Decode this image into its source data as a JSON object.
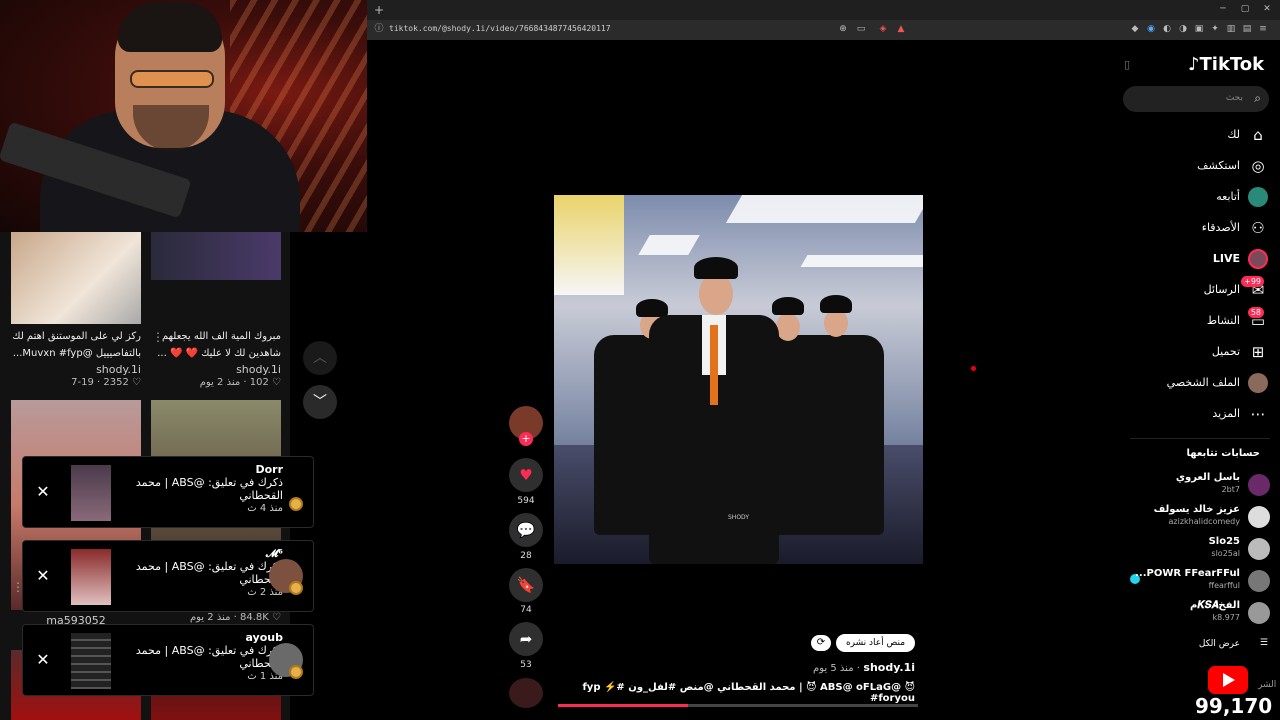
{
  "browser": {
    "url": "tiktok.com/@shody.1i/video/7668434877456420117"
  },
  "grid": {
    "cards": [
      {
        "caption": "ركز لي على الموستنق اهتم لك بالتفاصيييل @Muvxn #fyp...",
        "author": "shody.1i",
        "views": "2352",
        "age": "7-19"
      },
      {
        "caption": "مبروك المية الف الله يجعلهم شاهدين لك لا عليك ❤️ ❤️ ...",
        "author": "shody.1i",
        "views": "102",
        "age": "منذ 2 يوم"
      },
      {
        "views": "84.8K",
        "age": "منذ 2 يوم",
        "author": "ma593052"
      }
    ]
  },
  "notifications": [
    {
      "name": "Dorr",
      "text": "ذكرك في تعليق: @ABS | محمد القحطاني",
      "time": "منذ 4 ث"
    },
    {
      "name": "𝓜⁶",
      "text": "ذكرك في تعليق: @ABS | محمد القحطاني",
      "time": "منذ 2 ث"
    },
    {
      "name": "ayoub",
      "text": "ذكرك في تعليق: @ABS | محمد القحطاني",
      "time": "منذ 1 ث"
    }
  ],
  "video": {
    "likes": "594",
    "comments": "28",
    "saves": "74",
    "shares": "53",
    "author": "shody.1i",
    "age": "منذ 5 يوم",
    "caption": "😈 @ABS@ oFLaG 😈 | محمد القحطاني @منص #لفل_ون #⚡️ fyp #foryou",
    "repost_label": "منص أعاد نشره",
    "watermark": "SHODY",
    "progress": 0.36
  },
  "sidebar": {
    "logo": "TikTok",
    "search_placeholder": "بحث",
    "nav": [
      {
        "label": "لك",
        "icon": "⌂"
      },
      {
        "label": "استكشف",
        "icon": "◎"
      },
      {
        "label": "أتابعه",
        "icon": "●"
      },
      {
        "label": "الأصدقاء",
        "icon": "⚇"
      },
      {
        "label": "LIVE",
        "icon": "●"
      },
      {
        "label": "الرسائل",
        "icon": "✉",
        "badge": "99+"
      },
      {
        "label": "النشاط",
        "icon": "▭",
        "badge": "58"
      },
      {
        "label": "تحميل",
        "icon": "⊞"
      },
      {
        "label": "الملف الشخصي",
        "icon": "●"
      },
      {
        "label": "المزيد",
        "icon": "⋯"
      }
    ],
    "following_title": "حسابات تتابعها",
    "following": [
      {
        "name": "باسل العروي",
        "handle": "2bt7"
      },
      {
        "name": "عزيز خالد يسولف",
        "handle": "azizkhalidcomedy"
      },
      {
        "name": "Slo25",
        "handle": "slo25al"
      },
      {
        "name": "POWR FFearFFul...",
        "handle": "ffearfful"
      },
      {
        "name": "الفخ𝑲𝑺𝑨م",
        "handle": "k8.977"
      }
    ],
    "see_all": "عرض الكل",
    "footer_fragment": "الشر"
  },
  "overlay": {
    "subscriber_count": "99,170"
  },
  "colors": {
    "accent": "#fe2c55",
    "coin": "#e6b04a",
    "youtube": "#ff0000"
  }
}
